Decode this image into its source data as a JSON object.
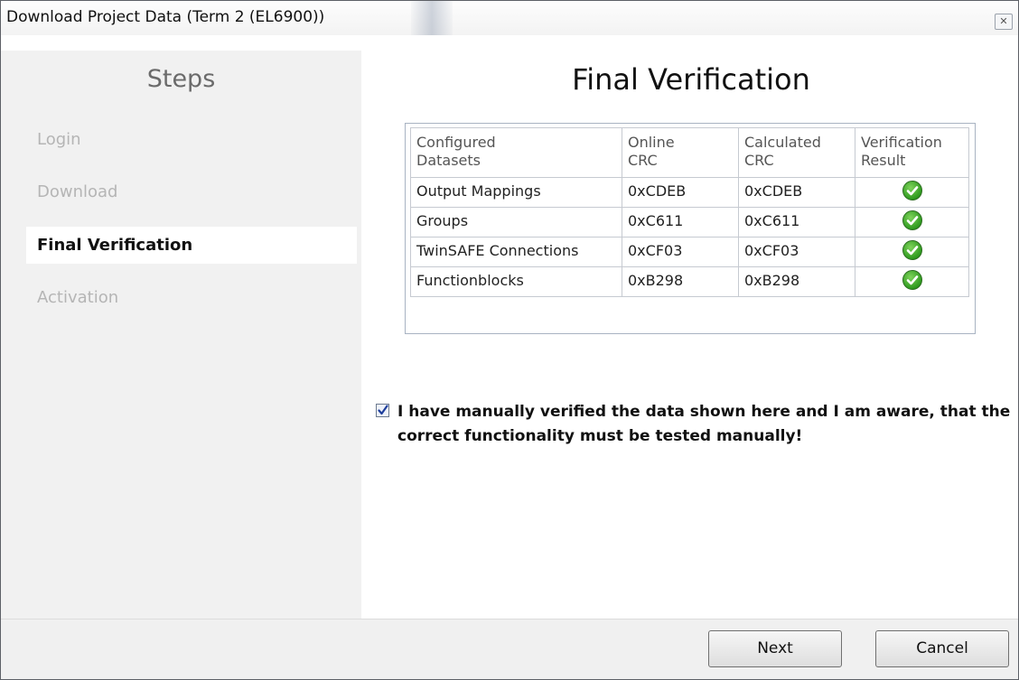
{
  "window": {
    "title": "Download Project Data (Term 2 (EL6900))",
    "close_icon": "close-icon"
  },
  "sidebar": {
    "title": "Steps",
    "items": [
      {
        "label": "Login",
        "state": "inactive"
      },
      {
        "label": "Download",
        "state": "inactive"
      },
      {
        "label": "Final Verification",
        "state": "active"
      },
      {
        "label": "Activation",
        "state": "inactive"
      }
    ]
  },
  "main": {
    "title": "Final Verification",
    "table": {
      "headers": [
        {
          "line1": "Configured",
          "line2": "Datasets"
        },
        {
          "line1": "Online",
          "line2": "CRC"
        },
        {
          "line1": "Calculated",
          "line2": "CRC"
        },
        {
          "line1": "Verification",
          "line2": "Result"
        }
      ],
      "rows": [
        {
          "dataset": "Output Mappings",
          "online": "0xCDEB",
          "calculated": "0xCDEB",
          "result": "check-icon"
        },
        {
          "dataset": "Groups",
          "online": "0xC611",
          "calculated": "0xC611",
          "result": "check-icon"
        },
        {
          "dataset": "TwinSAFE Connections",
          "online": "0xCF03",
          "calculated": "0xCF03",
          "result": "check-icon"
        },
        {
          "dataset": "Functionblocks",
          "online": "0xB298",
          "calculated": "0xB298",
          "result": "check-icon"
        }
      ]
    },
    "confirm": {
      "checked": true,
      "text": "I have manually verified the data shown here and I am aware, that the correct functionality must be tested manually!"
    }
  },
  "footer": {
    "next_label": "Next",
    "cancel_label": "Cancel"
  },
  "colors": {
    "check_green": "#2f9a1f",
    "sidebar_bg": "#f1f1f1",
    "inactive_text": "#b5b5b5"
  }
}
